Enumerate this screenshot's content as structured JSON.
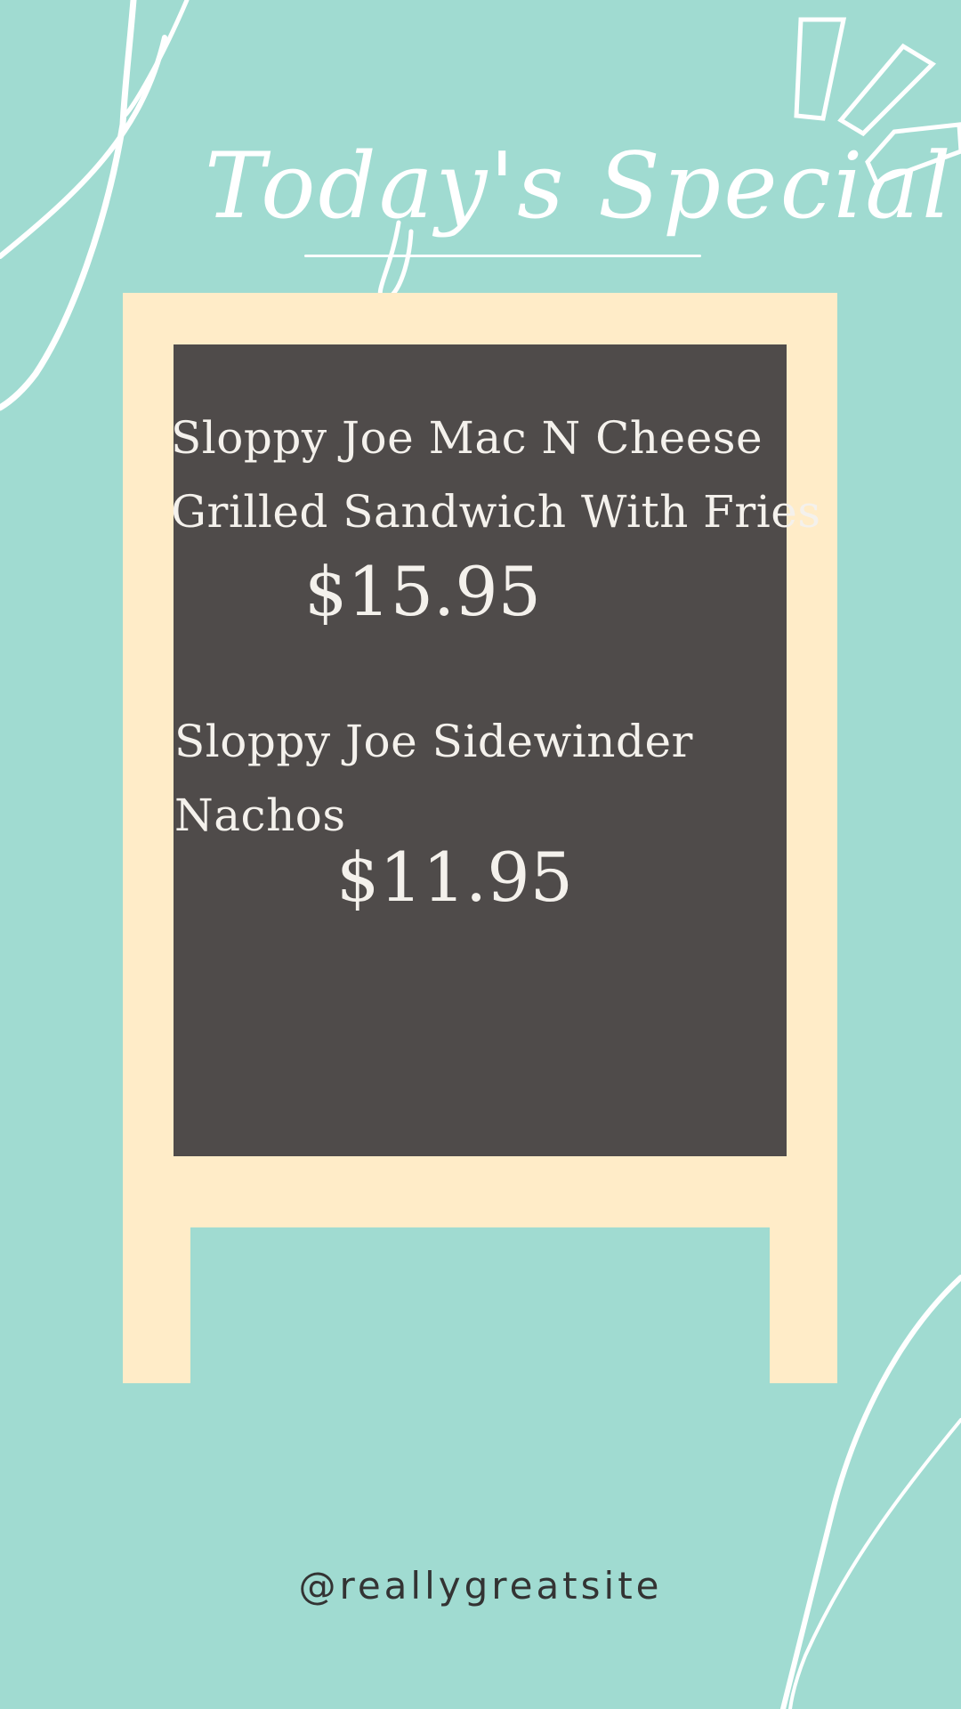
{
  "title": "Today's Special",
  "menu": {
    "items": [
      {
        "name_line1": "Sloppy Joe Mac N Cheese",
        "name_line2": "Grilled Sandwich With Fries",
        "price": "$15.95"
      },
      {
        "name_line1": "Sloppy Joe Sidewinder",
        "name_line2": "Nachos",
        "price": "$11.95"
      }
    ]
  },
  "footer": {
    "handle": "@reallygreatsite"
  },
  "colors": {
    "background": "#a0dbd1",
    "easel": "#ffecc8",
    "board": "#4f4b4a",
    "text_light": "#ffffff",
    "text_dark": "#333333"
  }
}
